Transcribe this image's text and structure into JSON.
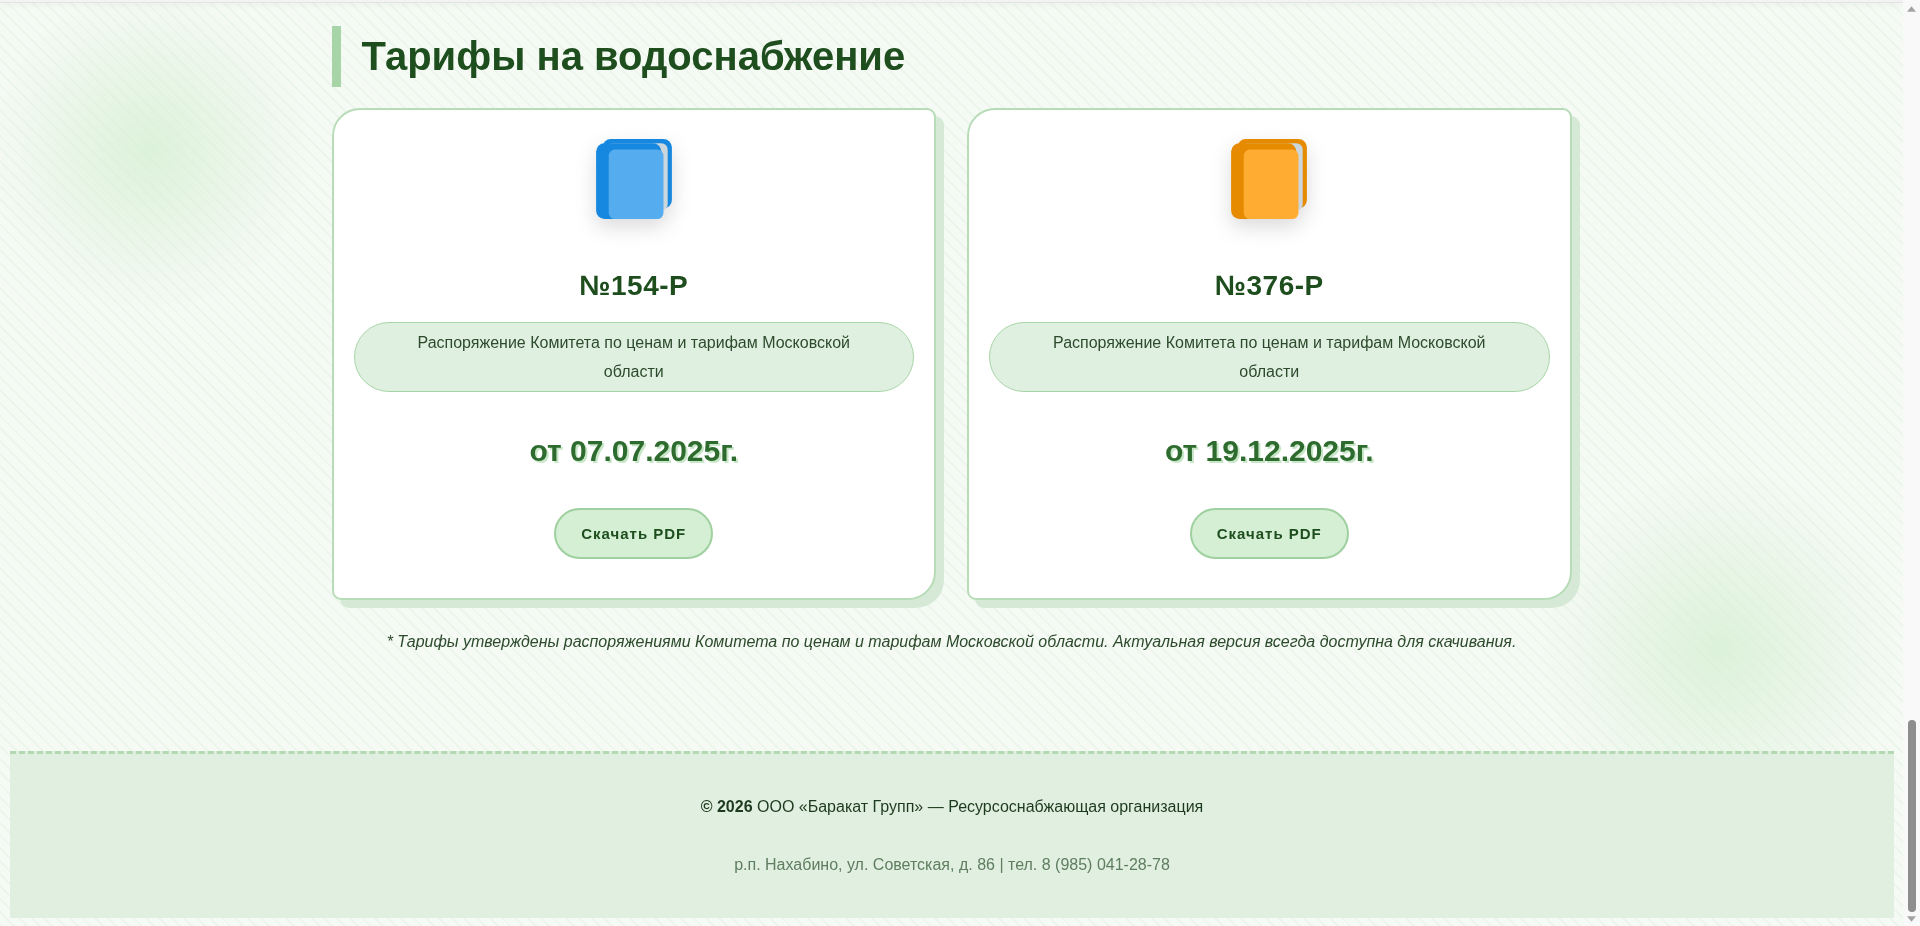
{
  "section": {
    "title": "Тарифы на водоснабжение"
  },
  "documents": [
    {
      "number": "№154-Р",
      "description": "Распоряжение Комитета по ценам и тарифам Московской области",
      "date": "от 07.07.2025г.",
      "button": "Скачать PDF",
      "color": "#55acee"
    },
    {
      "number": "№376-Р",
      "description": "Распоряжение Комитета по ценам и тарифам Московской области",
      "date": "от 19.12.2025г.",
      "button": "Скачать PDF",
      "color": "#ffac33"
    }
  ],
  "note": "* Тарифы утверждены распоряжениями Комитета по ценам и тарифам Московской области. Актуальная версия всегда доступна для скачивания.",
  "footer": {
    "copyright": "**© 2026** ООО «Баракат Групп» — Ресурсоснабжающая организация",
    "contacts": "р.п. Нахабино, ул. Советская, д. 86 | тел. 8 (985) 041-28-78"
  }
}
